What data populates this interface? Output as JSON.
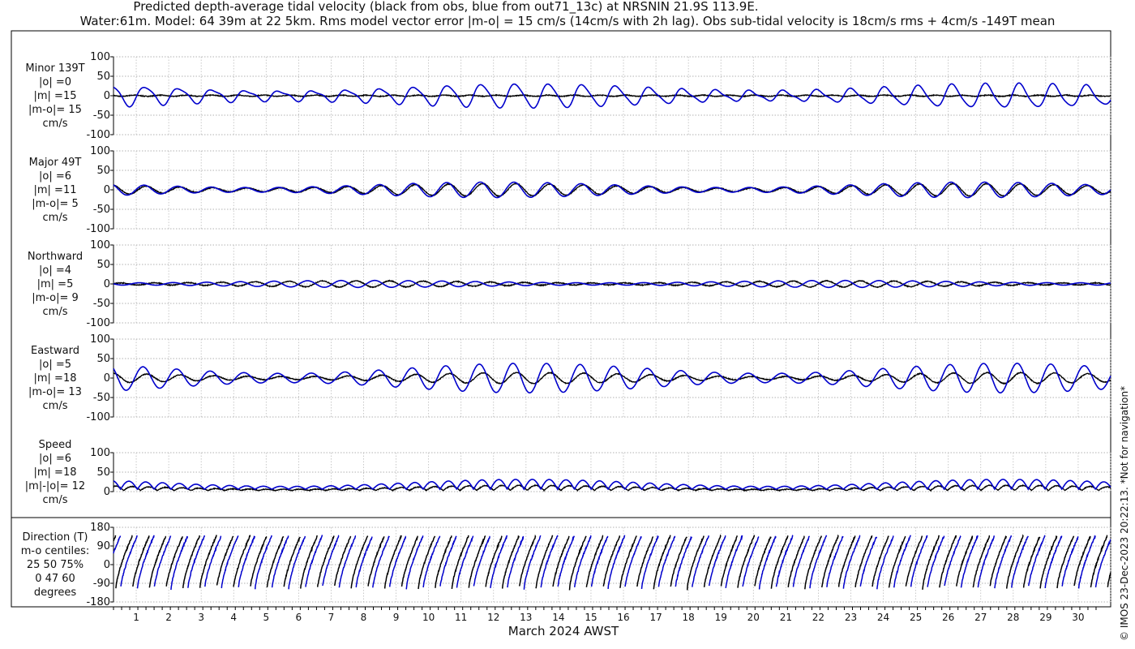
{
  "title_line1": "Predicted depth-average tidal velocity (black from obs, blue from out71_13c) at NRSNIN 21.9S 113.9E.",
  "title_line2": "Water:61m. Model: 64 39m at 22 5km. Rms model vector error |m-o| = 15 cm/s (14cm/s with 2h lag). Obs sub-tidal velocity is 18cm/s rms + 4cm/s -149T mean",
  "xlabel": "March 2024 AWST",
  "copyright": "© IMOS 23-Dec-2023 20:22:13. *Not for navigation*",
  "colors": {
    "obs": "#000000",
    "model": "#0000cc",
    "grid": "#999999"
  },
  "chart_data": [
    {
      "type": "line",
      "name": "minor",
      "label": "Minor 139T\n|o| =0\n|m| =15\n|m-o|= 15\ncm/s",
      "ylim": [
        -100,
        100
      ],
      "yticks": [
        "100",
        "50",
        "0",
        "-50",
        "-100"
      ],
      "xlim": [
        0.3,
        31
      ],
      "obs_amplitude": 3,
      "model_amplitude": [
        10,
        30
      ]
    },
    {
      "type": "line",
      "name": "major",
      "label": "Major 49T\n|o| =6\n|m| =11\n|m-o|= 5\ncm/s",
      "ylim": [
        -100,
        100
      ],
      "yticks": [
        "100",
        "50",
        "0",
        "-50",
        "-100"
      ],
      "xlim": [
        0.3,
        31
      ],
      "obs_amplitude": [
        5,
        20
      ],
      "model_amplitude": [
        5,
        22
      ]
    },
    {
      "type": "line",
      "name": "northward",
      "label": "Northward\n|o| =4\n|m| =5\n|m-o|= 9\ncm/s",
      "ylim": [
        -100,
        100
      ],
      "yticks": [
        "100",
        "50",
        "0",
        "-50",
        "-100"
      ],
      "xlim": [
        0.3,
        31
      ],
      "obs_amplitude": [
        3,
        8
      ],
      "model_amplitude": [
        2,
        10
      ]
    },
    {
      "type": "line",
      "name": "eastward",
      "label": "Eastward\n|o| =5\n|m| =18\n|m-o|= 13\ncm/s",
      "ylim": [
        -100,
        100
      ],
      "yticks": [
        "100",
        "50",
        "0",
        "-50",
        "-100"
      ],
      "xlim": [
        0.3,
        31
      ],
      "obs_amplitude": [
        5,
        15
      ],
      "model_amplitude": [
        10,
        38
      ]
    },
    {
      "type": "line",
      "name": "speed",
      "label": "Speed\n|o| =6\n|m| =18\n|m|-|o|= 12\ncm/s",
      "ylim": [
        0,
        100
      ],
      "yticks": [
        "100",
        "50",
        "0"
      ],
      "xlim": [
        0.3,
        31
      ],
      "obs_amplitude": [
        5,
        15
      ],
      "model_amplitude": [
        10,
        35
      ]
    },
    {
      "type": "line",
      "name": "direction",
      "label": "Direction (T)\nm-o centiles:\n25  50  75%\n0  47  60\ndegrees",
      "ylim": [
        -180,
        180
      ],
      "yticks": [
        "180",
        "90",
        "0",
        "-90",
        "-180"
      ],
      "xlim": [
        0.3,
        31
      ]
    }
  ],
  "xticks": [
    "1",
    "2",
    "3",
    "4",
    "5",
    "6",
    "7",
    "8",
    "9",
    "10",
    "11",
    "12",
    "13",
    "14",
    "15",
    "16",
    "17",
    "18",
    "19",
    "20",
    "21",
    "22",
    "23",
    "24",
    "25",
    "26",
    "27",
    "28",
    "29",
    "30"
  ]
}
